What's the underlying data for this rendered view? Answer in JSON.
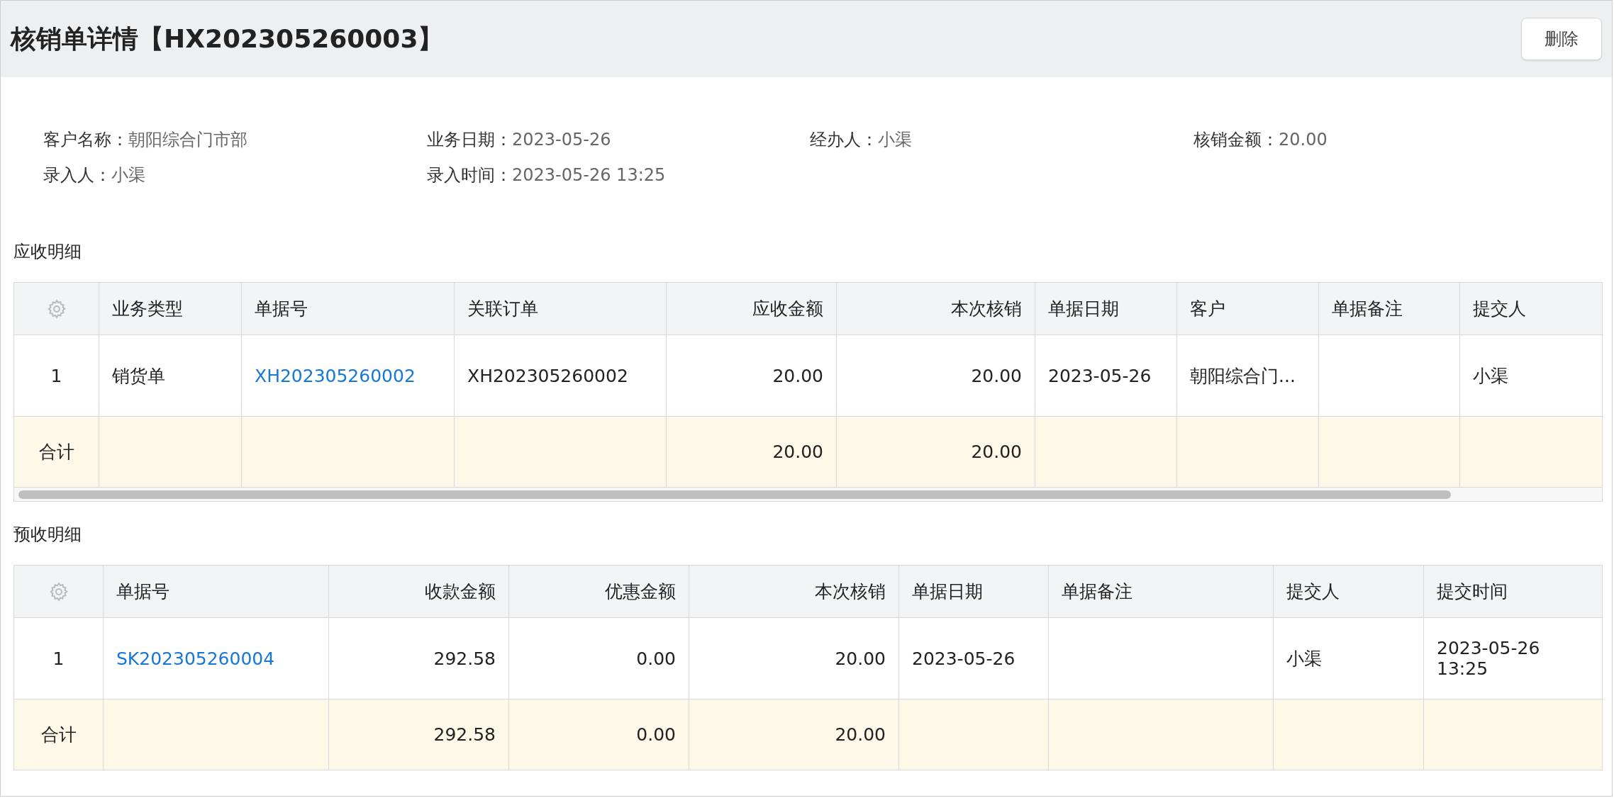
{
  "title": "核销单详情【HX202305260003】",
  "delete_button": "删除",
  "info": [
    {
      "label": "客户名称：",
      "value": "朝阳综合门市部"
    },
    {
      "label": "业务日期：",
      "value": "2023-05-26"
    },
    {
      "label": "经办人：",
      "value": "小渠"
    },
    {
      "label": "核销金额：",
      "value": "20.00"
    },
    {
      "label": "录入人：",
      "value": "小渠"
    },
    {
      "label": "录入时间：",
      "value": "2023-05-26 13:25"
    }
  ],
  "sections": [
    {
      "title": "应收明细",
      "horizontal_scrollbar": true,
      "columns": [
        "业务类型",
        "单据号",
        "关联订单",
        "应收金额",
        "本次核销",
        "单据日期",
        "客户",
        "单据备注",
        "提交人"
      ],
      "rows": [
        {
          "index": "1",
          "cells": [
            {
              "kind": "text",
              "text": "销货单"
            },
            {
              "kind": "link",
              "text": "XH202305260002"
            },
            {
              "kind": "text",
              "text": "XH202305260002"
            },
            {
              "kind": "text",
              "text": "20.00"
            },
            {
              "kind": "text",
              "text": "20.00"
            },
            {
              "kind": "text",
              "text": "2023-05-26"
            },
            {
              "kind": "text",
              "text": "朝阳综合门..."
            },
            null,
            {
              "kind": "text",
              "text": "小渠"
            }
          ]
        }
      ],
      "total": {
        "label": "合计",
        "cells": [
          null,
          null,
          null,
          "20.00",
          "20.00",
          null,
          null,
          null,
          null
        ]
      }
    },
    {
      "title": "预收明细",
      "horizontal_scrollbar": false,
      "columns": [
        "单据号",
        "收款金额",
        "优惠金额",
        "本次核销",
        "单据日期",
        "单据备注",
        "提交人",
        "提交时间"
      ],
      "rows": [
        {
          "index": "1",
          "cells": [
            {
              "kind": "link",
              "text": "SK202305260004"
            },
            {
              "kind": "text",
              "text": "292.58"
            },
            {
              "kind": "text",
              "text": "0.00"
            },
            {
              "kind": "text",
              "text": "20.00"
            },
            {
              "kind": "text",
              "text": "2023-05-26"
            },
            null,
            {
              "kind": "text",
              "text": "小渠"
            },
            {
              "kind": "text",
              "text": "2023-05-26 13:25"
            }
          ]
        }
      ],
      "total": {
        "label": "合计",
        "cells": [
          null,
          "292.58",
          "0.00",
          "20.00",
          null,
          null,
          null,
          null
        ]
      }
    }
  ]
}
